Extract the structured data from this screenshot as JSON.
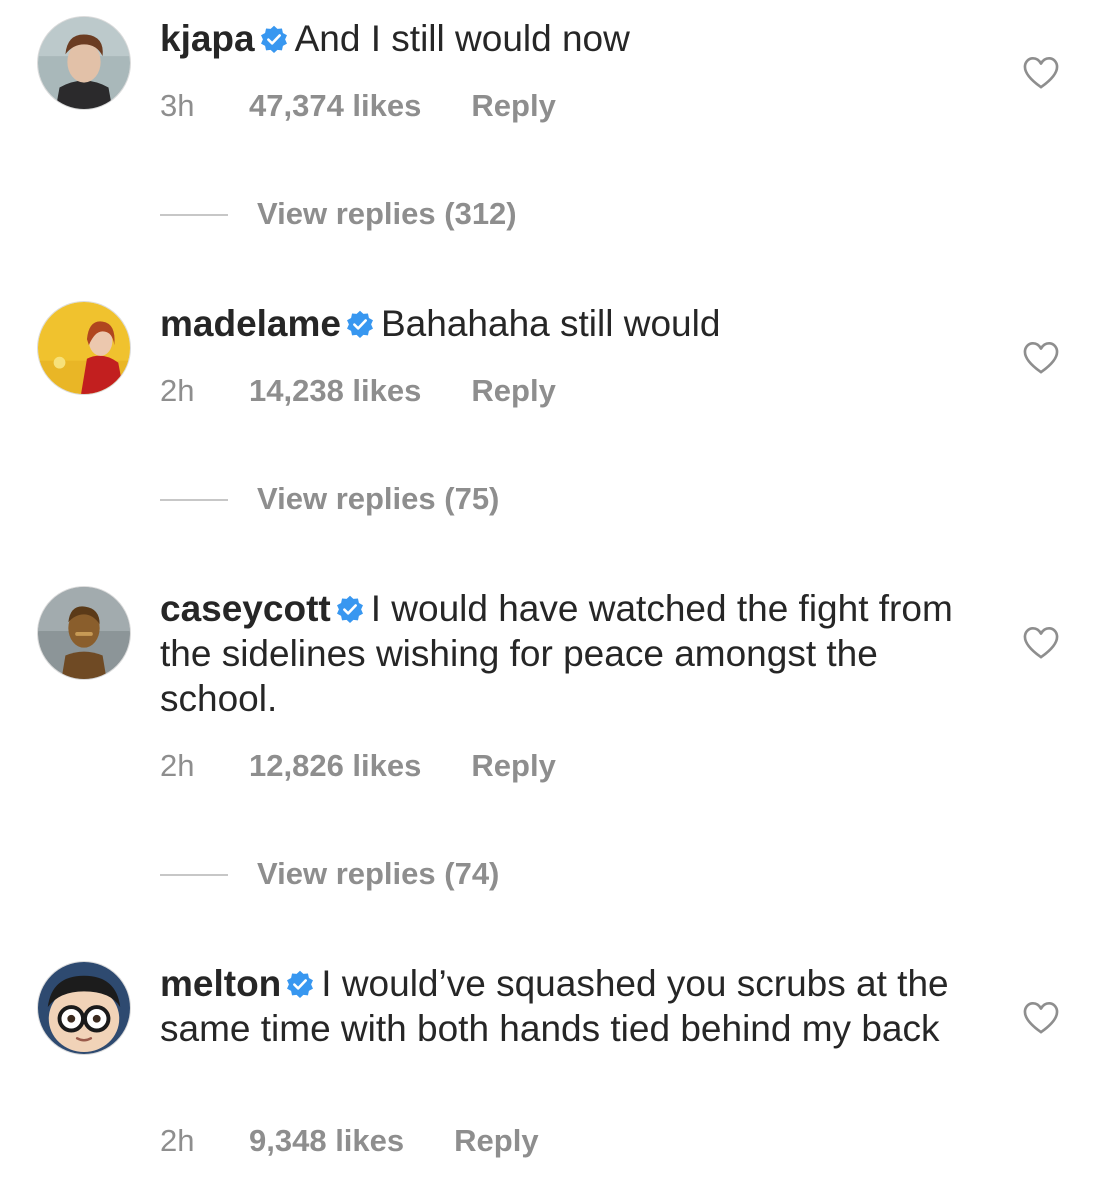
{
  "comments": [
    {
      "username": "kjapa",
      "text": "And I still would now",
      "time": "3h",
      "likes": "47,374 likes",
      "reply_label": "Reply",
      "view_replies": "View replies (312)",
      "verified": true
    },
    {
      "username": "madelame",
      "text": "Bahahaha still would",
      "time": "2h",
      "likes": "14,238 likes",
      "reply_label": "Reply",
      "view_replies": "View replies (75)",
      "verified": true
    },
    {
      "username": "caseycott",
      "text": "I would have watched the fight from the sidelines wishing for peace amongst the school.",
      "time": "2h",
      "likes": "12,826 likes",
      "reply_label": "Reply",
      "view_replies": "View replies (74)",
      "verified": true
    },
    {
      "username": "melton",
      "text": "I would’ve squashed you scrubs at the same time with both hands tied behind my back",
      "time": "2h",
      "likes": "9,348 likes",
      "reply_label": "Reply",
      "verified": true
    }
  ],
  "icons": {
    "verified": "verified-badge-icon",
    "like": "heart-outline-icon"
  },
  "colors": {
    "verified_blue": "#3897f0",
    "text_primary": "#262626",
    "text_secondary": "#8e8e8e"
  }
}
